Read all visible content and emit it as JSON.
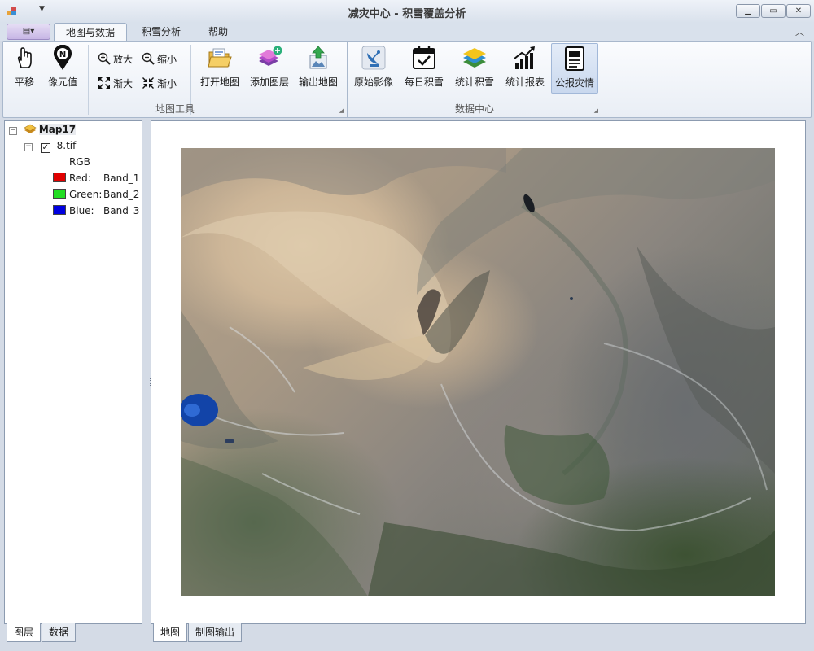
{
  "window": {
    "title": "减灾中心 - 积雪覆盖分析",
    "controls": {
      "minimize": "minimize",
      "maximize": "maximize",
      "close": "close"
    }
  },
  "ribbon": {
    "tabs": [
      {
        "label": "地图与数据",
        "active": true
      },
      {
        "label": "积雪分析",
        "active": false
      },
      {
        "label": "帮助",
        "active": false
      }
    ],
    "groups": {
      "map_tools": {
        "label": "地图工具",
        "pan": "平移",
        "pixel_value": "像元值",
        "zoom_in": "放大",
        "zoom_out": "缩小",
        "gradual_in": "渐大",
        "gradual_out": "渐小",
        "open_map": "打开地图",
        "add_layer": "添加图层",
        "export_map": "输出地图"
      },
      "data_center": {
        "label": "数据中心",
        "raw_image": "原始影像",
        "daily_snow": "每日积雪",
        "stat_snow": "统计积雪",
        "stat_report": "统计报表",
        "disaster_report": "公报灾情"
      }
    }
  },
  "toc": {
    "map_name": "Map17",
    "layer_name": "8.tif",
    "layer_checked": true,
    "render_type": "RGB",
    "bands": [
      {
        "channel": "Red:",
        "band": "Band_1",
        "color": "#e00000"
      },
      {
        "channel": "Green:",
        "band": "Band_2",
        "color": "#22dd22"
      },
      {
        "channel": "Blue:",
        "band": "Band_3",
        "color": "#0000e0"
      }
    ]
  },
  "left_tabs": [
    {
      "label": "图层",
      "active": true
    },
    {
      "label": "数据",
      "active": false
    }
  ],
  "view_tabs": [
    {
      "label": "地图",
      "active": true
    },
    {
      "label": "制图输出",
      "active": false
    }
  ],
  "colors": {
    "accent": "#3b6db3",
    "ribbon_bg": "#e9eef5",
    "window_bg": "#d4dbe6"
  }
}
